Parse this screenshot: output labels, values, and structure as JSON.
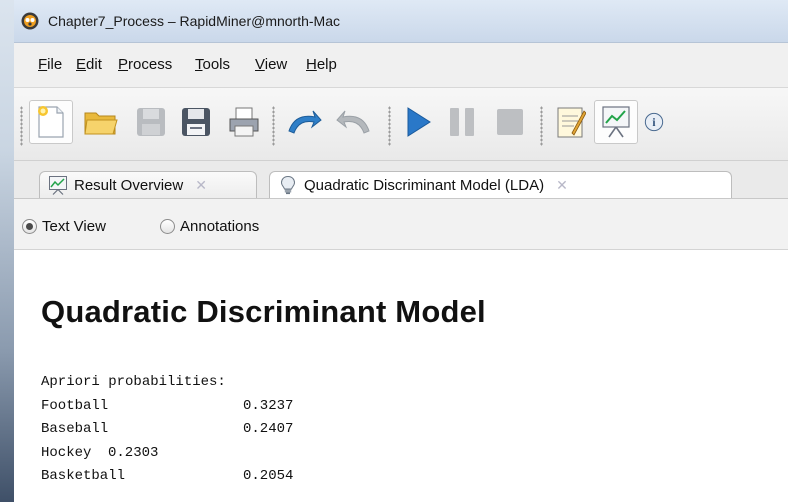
{
  "window": {
    "title": "Chapter7_Process – RapidMiner@mnorth-Mac"
  },
  "menu": {
    "items": [
      {
        "mnemonic": "F",
        "rest": "ile"
      },
      {
        "mnemonic": "E",
        "rest": "dit"
      },
      {
        "mnemonic": "P",
        "rest": "rocess"
      },
      {
        "mnemonic": "T",
        "rest": "ools"
      },
      {
        "mnemonic": "V",
        "rest": "iew"
      },
      {
        "mnemonic": "H",
        "rest": "elp"
      }
    ]
  },
  "toolbar": {
    "icons": [
      "new-process-icon",
      "open-folder-icon",
      "save-icon",
      "save-as-icon",
      "print-icon",
      "undo-icon",
      "redo-icon",
      "run-icon",
      "pause-icon",
      "stop-icon",
      "design-perspective-icon",
      "result-perspective-icon",
      "info-icon"
    ]
  },
  "tabs": [
    {
      "label": "Result Overview",
      "icon": "chart-icon",
      "close": "✕"
    },
    {
      "label": "Quadratic Discriminant Model (LDA)",
      "icon": "lightbulb-icon",
      "close": "✕"
    }
  ],
  "view_options": [
    {
      "label": "Text View",
      "selected": true
    },
    {
      "label": "Annotations",
      "selected": false
    }
  ],
  "model": {
    "title": "Quadratic Discriminant Model",
    "apriori_heading": "Apriori probabilities:",
    "rows": [
      {
        "label": "Football",
        "value": "0.3237"
      },
      {
        "label": "Baseball",
        "value": "0.2407"
      },
      {
        "label": "Hockey",
        "value": "0.2303"
      },
      {
        "label": "Basketball",
        "value": "0.2054"
      }
    ]
  },
  "colors": {
    "titlebar": "#d6e2f0",
    "run_blue": "#2a78c8",
    "window_bg": "#ffffff"
  }
}
